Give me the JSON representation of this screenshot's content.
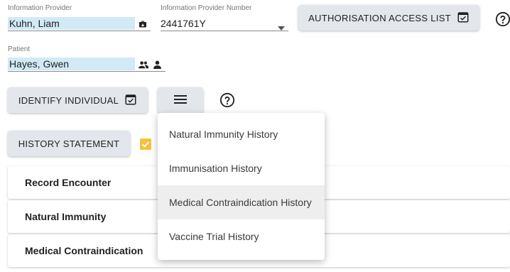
{
  "provider": {
    "label": "Information Provider",
    "value": "Kuhn, Liam",
    "icon": "briefcase-lock-icon"
  },
  "provider_number": {
    "label": "Information Provider Number",
    "value": "2441761Y",
    "icon": "dropdown-arrow-icon"
  },
  "auth_button": {
    "label": "AUTHORISATION ACCESS LIST",
    "icon": "checkbox-calendar-icon"
  },
  "patient": {
    "label": "Patient",
    "value": "Hayes, Gwen",
    "icons": [
      "people-icon",
      "person-icon"
    ]
  },
  "identify_button": {
    "label": "IDENTIFY INDIVIDUAL",
    "icon": "checkbox-calendar-icon"
  },
  "menu_button": {
    "icon": "hamburger-menu-icon"
  },
  "help_icon": "help-circle-icon",
  "history_button": {
    "label": "HISTORY STATEMENT"
  },
  "checkbox": {
    "checked": true,
    "color": "#f5c33b"
  },
  "cards": [
    {
      "label": "Record Encounter"
    },
    {
      "label": "Natural Immunity"
    },
    {
      "label": "Medical Contraindication"
    }
  ],
  "dropdown_menu": {
    "items": [
      {
        "label": "Natural Immunity History"
      },
      {
        "label": "Immunisation History"
      },
      {
        "label": "Medical Contraindication History",
        "hovered": true
      },
      {
        "label": "Vaccine Trial History"
      }
    ]
  },
  "colors": {
    "field_highlight": "#d1eaf6",
    "button_bg": "#e3e7eb",
    "checkbox": "#f5c33b"
  }
}
